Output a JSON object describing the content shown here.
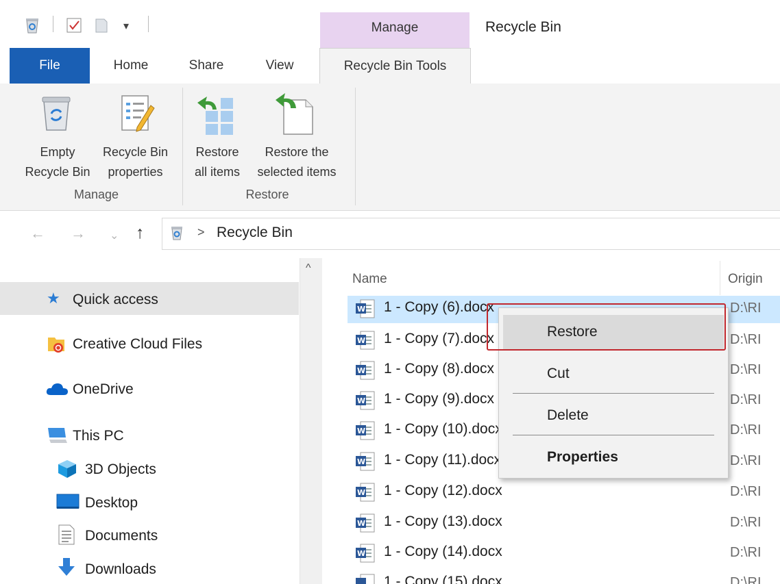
{
  "window": {
    "title": "Recycle Bin"
  },
  "ribbon": {
    "context_tab": "Manage",
    "tabs": [
      {
        "label": "File"
      },
      {
        "label": "Home"
      },
      {
        "label": "Share"
      },
      {
        "label": "View"
      },
      {
        "label": "Recycle Bin Tools"
      }
    ],
    "buttons": {
      "empty_line1": "Empty",
      "empty_line2": "Recycle Bin",
      "props_line1": "Recycle Bin",
      "props_line2": "properties",
      "restore_all_line1": "Restore",
      "restore_all_line2": "all items",
      "restore_sel_line1": "Restore the",
      "restore_sel_line2": "selected items"
    },
    "groups": {
      "manage": "Manage",
      "restore": "Restore"
    }
  },
  "address": {
    "path": "Recycle Bin",
    "separator": ">"
  },
  "nav": {
    "items": [
      {
        "label": "Quick access"
      },
      {
        "label": "Creative Cloud Files"
      },
      {
        "label": "OneDrive"
      },
      {
        "label": "This PC"
      },
      {
        "label": "3D Objects"
      },
      {
        "label": "Desktop"
      },
      {
        "label": "Documents"
      },
      {
        "label": "Downloads"
      }
    ]
  },
  "list": {
    "columns": {
      "name": "Name",
      "original": "Origin"
    },
    "rows": [
      {
        "name": "1 - Copy (6).docx",
        "original": "D:\\RI"
      },
      {
        "name": "1 - Copy (7).docx",
        "original": "D:\\RI"
      },
      {
        "name": "1 - Copy (8).docx",
        "original": "D:\\RI"
      },
      {
        "name": "1 - Copy (9).docx",
        "original": "D:\\RI"
      },
      {
        "name": "1 - Copy (10).docx",
        "original": "D:\\RI"
      },
      {
        "name": "1 - Copy (11).docx",
        "original": "D:\\RI"
      },
      {
        "name": "1 - Copy (12).docx",
        "original": "D:\\RI"
      },
      {
        "name": "1 - Copy (13).docx",
        "original": "D:\\RI"
      },
      {
        "name": "1 - Copy (14).docx",
        "original": "D:\\RI"
      },
      {
        "name": "1 - Copy (15).docx",
        "original": "D:\\RI"
      }
    ]
  },
  "context_menu": {
    "items": [
      {
        "label": "Restore"
      },
      {
        "label": "Cut"
      },
      {
        "label": "Delete"
      },
      {
        "label": "Properties"
      }
    ]
  },
  "colors": {
    "file_tab": "#1a5fb4",
    "context_tab": "#e8d3f0",
    "callout": "#c1272d",
    "selection": "#cce8ff"
  }
}
